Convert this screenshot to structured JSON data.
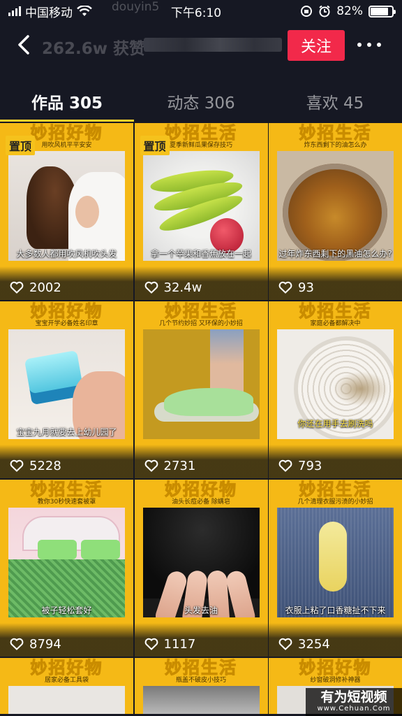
{
  "status_bar": {
    "carrier": "中国移动",
    "time": "下午6:10",
    "battery": "82%",
    "battery_level": 0.82,
    "overlay_id": "douyin5"
  },
  "header": {
    "follow_count": "262.6w 获赞",
    "follow_label": "关注"
  },
  "tabs": [
    {
      "label": "作品 305",
      "active": true
    },
    {
      "label": "动态 306",
      "active": false
    },
    {
      "label": "喜欢 45",
      "active": false
    }
  ],
  "videos": [
    {
      "banner": "妙招好物",
      "sub": "用吹风机平平安安",
      "caption": "大多数人都用吹风机吹头发",
      "likes": "2002",
      "pinned": "置顶"
    },
    {
      "banner": "妙招生活",
      "sub": "夏季新鲜瓜果保存技巧",
      "caption": "拿一个苹果和香蕉放在一起",
      "likes": "32.4w",
      "pinned": "置顶"
    },
    {
      "banner": "妙招生活",
      "sub": "炸东西剩下的油怎么办",
      "caption": "过年炸东西剩下的黑油怎么办?",
      "likes": "93",
      "pinned": ""
    },
    {
      "banner": "妙招好物",
      "sub": "宝宝开学必备姓名印章",
      "caption": "宝宝九月就要去上幼儿园了",
      "likes": "5228",
      "pinned": ""
    },
    {
      "banner": "妙招生活",
      "sub": "几个节约妙招 又环保的小妙招",
      "caption": "",
      "likes": "2731",
      "pinned": ""
    },
    {
      "banner": "妙招生活",
      "sub": "家庭必备都解决中",
      "caption": "你还在用手去刷洗吗",
      "likes": "793",
      "pinned": ""
    },
    {
      "banner": "妙招生活",
      "sub": "教你30秒快速套被罩",
      "caption": "被子轻松套好",
      "likes": "8794",
      "pinned": ""
    },
    {
      "banner": "妙招好物",
      "sub": "油头长痘必备 除螨皂",
      "caption": "头发去油",
      "likes": "1117",
      "pinned": ""
    },
    {
      "banner": "妙招生活",
      "sub": "几个清理衣服污渍的小妙招",
      "caption": "衣服上粘了口香糖扯不下来",
      "likes": "3254",
      "pinned": ""
    },
    {
      "banner": "妙招好物",
      "sub": "居家必备工具袋",
      "caption": "",
      "likes": "",
      "pinned": ""
    },
    {
      "banner": "妙招生活",
      "sub": "瓶盖不破皮小技巧",
      "caption": "",
      "likes": "",
      "pinned": ""
    },
    {
      "banner": "妙招好物",
      "sub": "纱窗破洞修补神器",
      "caption": "",
      "likes": "",
      "pinned": ""
    }
  ],
  "site_watermark": {
    "title": "有为短视频",
    "url": "www.Cehuan.Com"
  },
  "colors": {
    "background": "#161823",
    "accent": "#f2294a",
    "tab_indicator": "#fdd22a",
    "card": "#f5b916"
  }
}
